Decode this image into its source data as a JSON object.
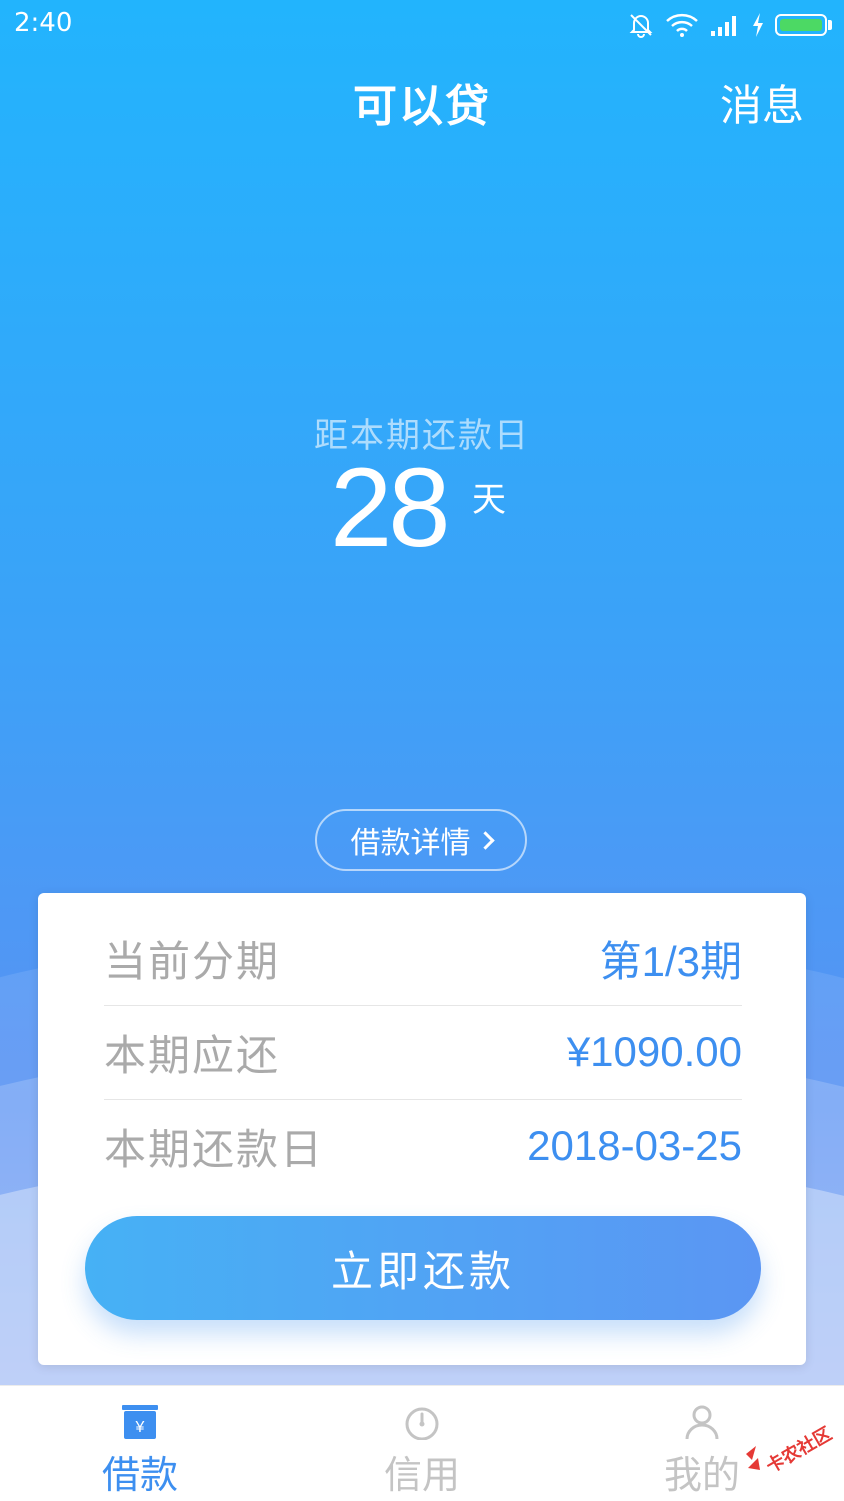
{
  "status_bar": {
    "time": "2:40",
    "icons": [
      "bell-off-icon",
      "wifi-icon",
      "signal-icon",
      "charging-icon",
      "battery-icon"
    ],
    "battery_color": "#4cd964"
  },
  "header": {
    "title": "可以贷",
    "messages_label": "消息"
  },
  "countdown": {
    "label": "距本期还款日",
    "days": "28",
    "unit": "天"
  },
  "detail_button": {
    "label": "借款详情"
  },
  "repayment_card": {
    "rows": [
      {
        "label": "当前分期",
        "value": "第1/3期"
      },
      {
        "label": "本期应还",
        "value": "¥1090.00"
      },
      {
        "label": "本期还款日",
        "value": "2018-03-25"
      }
    ],
    "repay_button_label": "立即还款"
  },
  "tab_bar": {
    "active_index": 0,
    "tabs": [
      {
        "label": "借款",
        "icon": "loan-icon"
      },
      {
        "label": "信用",
        "icon": "gauge-icon"
      },
      {
        "label": "我的",
        "icon": "user-icon"
      }
    ]
  },
  "watermark": {
    "text": "卡农社区"
  },
  "colors": {
    "accent": "#3d8ff0",
    "hero_top": "#22b4fd",
    "hero_bottom": "#5a92f3",
    "muted_label": "#aaaaaa"
  }
}
